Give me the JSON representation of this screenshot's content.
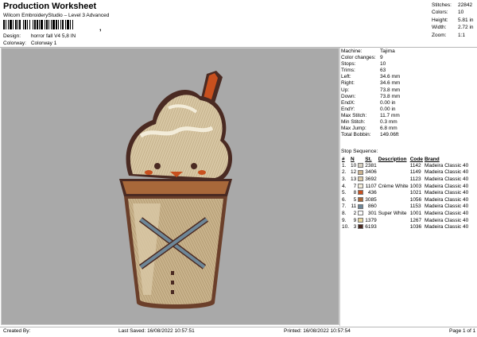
{
  "header": {
    "title": "Production Worksheet",
    "subtitle": "Wilcom EmbroideryStudio – Level 3 Advanced",
    "barcode_suffix": ","
  },
  "meta": {
    "design_label": "Design:",
    "design_value": "horror fall V4 5,8 IN",
    "colorway_label": "Colorway:",
    "colorway_value": "Colorway 1"
  },
  "top_stats": [
    {
      "label": "Stitches:",
      "value": "22842"
    },
    {
      "label": "Colors:",
      "value": "10"
    },
    {
      "label": "Height:",
      "value": "5.81 in"
    },
    {
      "label": "Width:",
      "value": "2.72 in"
    },
    {
      "label": "Zoom:",
      "value": "1:1"
    }
  ],
  "info": [
    {
      "label": "Machine:",
      "value": "Tajima"
    },
    {
      "label": "Color changes:",
      "value": "9"
    },
    {
      "label": "Stops:",
      "value": "10"
    },
    {
      "label": "Trims:",
      "value": "63"
    },
    {
      "label": "Left:",
      "value": "34.6 mm"
    },
    {
      "label": "Right:",
      "value": "34.6 mm"
    },
    {
      "label": "Up:",
      "value": "73.8 mm"
    },
    {
      "label": "Down:",
      "value": "73.8 mm"
    },
    {
      "label": "EndX:",
      "value": "0.00 in"
    },
    {
      "label": "EndY:",
      "value": "0.00 in"
    },
    {
      "label": "Max Stitch:",
      "value": "11.7 mm"
    },
    {
      "label": "Min Stitch:",
      "value": "0.3 mm"
    },
    {
      "label": "Max Jump:",
      "value": "6.8 mm"
    },
    {
      "label": "Total Bobbin:",
      "value": "149.06ft"
    }
  ],
  "stop_sequence": {
    "title": "Stop Sequence:",
    "headers": {
      "idx": "#",
      "n": "N",
      "st": "St.",
      "desc": "Description",
      "code": "Code",
      "brand": "Brand"
    },
    "rows": [
      {
        "idx": "1.",
        "n": "10",
        "color": "#d6cfc0",
        "st": "2381",
        "desc": "",
        "code": "1142",
        "brand": "Madeira Classic 40"
      },
      {
        "idx": "2.",
        "n": "12",
        "color": "#c9b08c",
        "st": "3406",
        "desc": "",
        "code": "1149",
        "brand": "Madeira Classic 40"
      },
      {
        "idx": "3.",
        "n": "13",
        "color": "#d9c8a6",
        "st": "3692",
        "desc": "",
        "code": "1123",
        "brand": "Madeira Classic 40"
      },
      {
        "idx": "4.",
        "n": "7",
        "color": "#f3ecd9",
        "st": "1107",
        "desc": "Crème White",
        "code": "1003",
        "brand": "Madeira Classic 40"
      },
      {
        "idx": "5.",
        "n": "8",
        "color": "#c8501e",
        "st": "436",
        "desc": "",
        "code": "1021",
        "brand": "Madeira Classic 40"
      },
      {
        "idx": "6.",
        "n": "5",
        "color": "#a8683a",
        "st": "3085",
        "desc": "",
        "code": "1056",
        "brand": "Madeira Classic 40"
      },
      {
        "idx": "7.",
        "n": "11",
        "color": "#6e8798",
        "st": "860",
        "desc": "",
        "code": "1153",
        "brand": "Madeira Classic 40"
      },
      {
        "idx": "8.",
        "n": "2",
        "color": "#fafafa",
        "st": "301",
        "desc": "Super White",
        "code": "1001",
        "brand": "Madeira Classic 40"
      },
      {
        "idx": "9.",
        "n": "9",
        "color": "#e8d59a",
        "st": "1379",
        "desc": "",
        "code": "1267",
        "brand": "Madeira Classic 40"
      },
      {
        "idx": "10.",
        "n": "3",
        "color": "#4a2a22",
        "st": "6193",
        "desc": "",
        "code": "1036",
        "brand": "Madeira Classic 40"
      }
    ]
  },
  "footer": {
    "created_by": "Created By:",
    "last_saved": "Last Saved: 16/08/2022 10:57:51",
    "printed": "Printed: 16/08/2022 10:57:54",
    "page": "Page 1 of 1"
  }
}
